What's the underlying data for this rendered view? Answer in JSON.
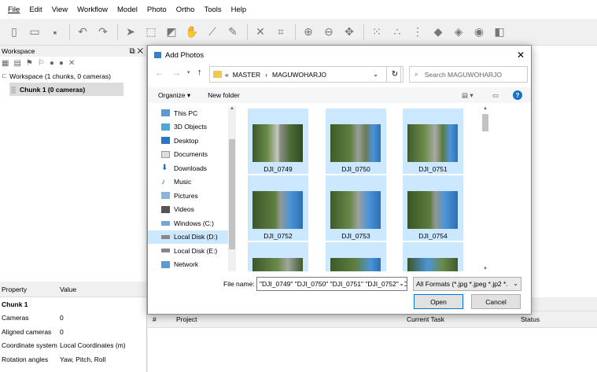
{
  "menu": [
    "File",
    "Edit",
    "View",
    "Workflow",
    "Model",
    "Photo",
    "Ortho",
    "Tools",
    "Help"
  ],
  "workspace": {
    "title": "Workspace",
    "root": "Workspace (1 chunks, 0 cameras)",
    "chunk": "Chunk 1 (0 cameras)"
  },
  "properties": {
    "col_property": "Property",
    "col_value": "Value",
    "rows": [
      {
        "k": "Chunk 1",
        "v": ""
      },
      {
        "k": "Cameras",
        "v": "0"
      },
      {
        "k": "Aligned cameras",
        "v": "0"
      },
      {
        "k": "Coordinate system",
        "v": "Local Coordinates (m)"
      },
      {
        "k": "Rotation angles",
        "v": "Yaw, Pitch, Roll"
      }
    ]
  },
  "jobs": {
    "col_num": "#",
    "col_project": "Project",
    "col_task": "Current Task",
    "col_status": "Status"
  },
  "dialog": {
    "title": "Add Photos",
    "breadcrumb_prefix": "«",
    "breadcrumb_1": "MASTER",
    "breadcrumb_2": "MAGUWOHARJO",
    "search_placeholder": "Search MAGUWOHARJO",
    "organize": "Organize",
    "new_folder": "New folder",
    "nav_items": [
      "This PC",
      "3D Objects",
      "Desktop",
      "Documents",
      "Downloads",
      "Music",
      "Pictures",
      "Videos",
      "Windows (C:)",
      "Local Disk (D:)",
      "Local Disk (E:)",
      "Network"
    ],
    "files": [
      "DJI_0749",
      "DJI_0750",
      "DJI_0751",
      "DJI_0752",
      "DJI_0753",
      "DJI_0754"
    ],
    "file_name_label": "File name:",
    "file_name_value": "\"DJI_0749\" \"DJI_0750\" \"DJI_0751\" \"DJI_0752\" \"D",
    "format_value": "All Formats (*.jpg *.jpeg *.jp2 *.",
    "open_label": "Open",
    "cancel_label": "Cancel"
  }
}
